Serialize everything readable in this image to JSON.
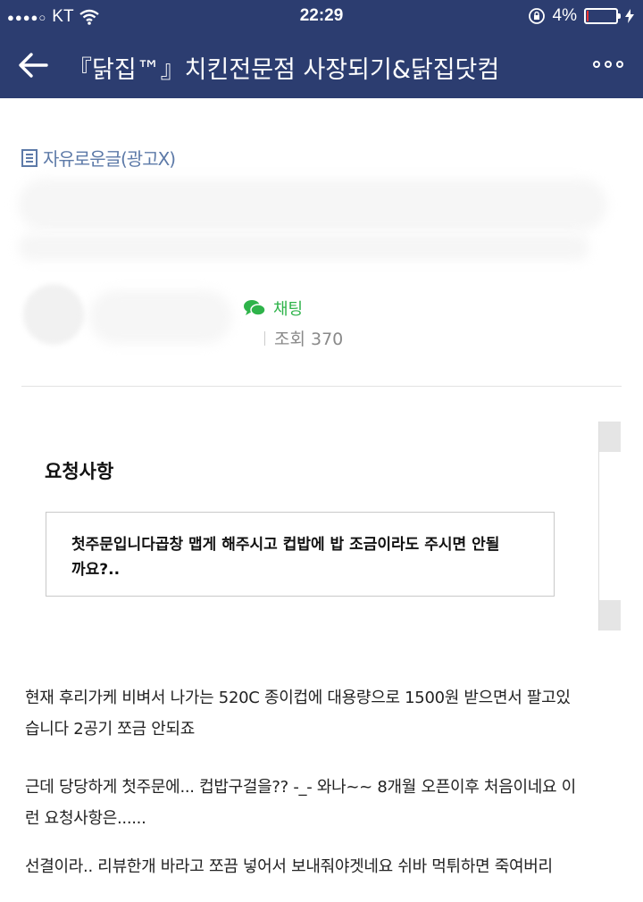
{
  "status_bar": {
    "carrier": "KT",
    "time": "22:29",
    "battery": "4%",
    "icons": [
      "signal-dots-icon",
      "wifi-icon",
      "orientation-lock-icon",
      "battery-icon",
      "charging-bolt-icon"
    ]
  },
  "app_bar": {
    "title": "『닭집™』치킨전문점 사장되기&닭집닷컴",
    "background": "#2c3d70",
    "icons": [
      "back-arrow-icon",
      "more-options-icon"
    ]
  },
  "post": {
    "board_name": "자유로운글(광고X)",
    "chat_label": "채팅",
    "views_label": "조회 370"
  },
  "request": {
    "heading": "요청사항",
    "text_line1": "첫주문입니다곱창 맵게 해주시고 컵밥에 밥 조금이라도 주시면 안될",
    "text_line2": "까요?.."
  },
  "content": {
    "p1_line1": "현재 후리가케 비벼서 나가는 520C 종이컵에 대용량으로 1500원 받으면서 팔고있",
    "p1_line2": "습니다  2공기 쪼금 안되죠",
    "p2_line1": "근데 당당하게 첫주문에... 컵밥구걸을?? -_- 와나~~ 8개월 오픈이후 처음이네요 이",
    "p2_line2": "런 요청사항은......",
    "p3_line1": "선결이라.. 리뷰한개 바라고 쪼끔 넣어서 보내줘야겟네요 쉬바 먹튀하면 죽여버리"
  },
  "colors": {
    "header": "#2c3d70",
    "board_link": "#5d7aa8",
    "chat_green": "#2eb34a",
    "battery_low": "#e33333"
  }
}
